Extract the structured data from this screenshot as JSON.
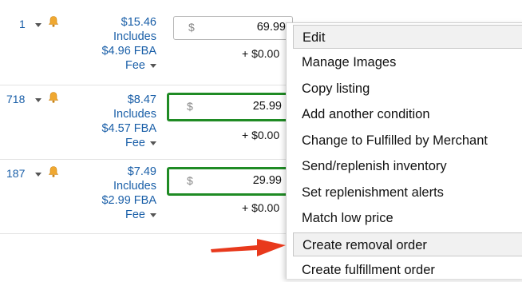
{
  "rows": [
    {
      "rank_fragment": "1",
      "price": "$15.46",
      "includes": "Includes",
      "fba_fee": "$4.96 FBA",
      "fee_label": "Fee",
      "currency_symbol": "$",
      "amount": "69.99",
      "shipping": "+ $0.00",
      "highlighted": false
    },
    {
      "rank_fragment": "718",
      "price": "$8.47",
      "includes": "Includes",
      "fba_fee": "$4.57 FBA",
      "fee_label": "Fee",
      "currency_symbol": "$",
      "amount": "25.99",
      "shipping": "+ $0.00",
      "highlighted": true
    },
    {
      "rank_fragment": "187",
      "price": "$7.49",
      "includes": "Includes",
      "fba_fee": "$2.99 FBA",
      "fee_label": "Fee",
      "currency_symbol": "$",
      "amount": "29.99",
      "shipping": "+ $0.00",
      "highlighted": true
    }
  ],
  "menu": {
    "items": [
      {
        "label": "Edit"
      },
      {
        "label": "Manage Images"
      },
      {
        "label": "Copy listing"
      },
      {
        "label": "Add another condition"
      },
      {
        "label": "Change to Fulfilled by Merchant"
      },
      {
        "label": "Send/replenish inventory"
      },
      {
        "label": "Set replenishment alerts"
      },
      {
        "label": "Match low price"
      },
      {
        "label": "Create removal order"
      },
      {
        "label": "Create fulfillment order"
      }
    ],
    "hovered_item": "Create removal order"
  },
  "colors": {
    "link_blue": "#1a5fa8",
    "highlight_green": "#1f8b24",
    "bell_orange": "#f0a830",
    "arrow_red": "#e8391c"
  },
  "icons": {
    "alert": "bell-icon",
    "dropdown": "caret-down-icon",
    "pointer": "red-arrow"
  }
}
